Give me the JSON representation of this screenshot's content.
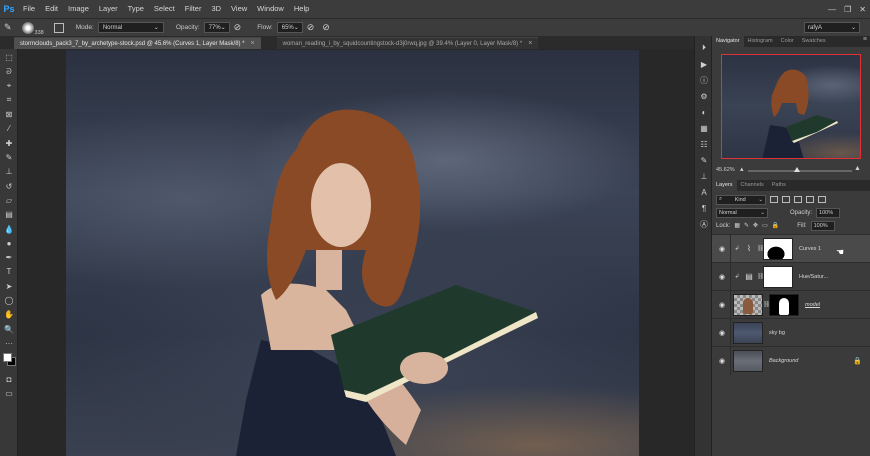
{
  "app": {
    "logo": "Ps"
  },
  "menu": [
    "File",
    "Edit",
    "Image",
    "Layer",
    "Type",
    "Select",
    "Filter",
    "3D",
    "View",
    "Window",
    "Help"
  ],
  "window_controls": {
    "minimize": "—",
    "restore": "❐",
    "close": "✕"
  },
  "options": {
    "brush_size": "338",
    "mode_label": "Mode:",
    "mode_value": "Normal",
    "opacity_label": "Opacity:",
    "opacity_value": "77%",
    "flow_label": "Flow:",
    "flow_value": "65%",
    "workspace": "rafyA"
  },
  "tabs": [
    {
      "label": "stormclouds_pack3_7_by_archetype-stock.psd @ 45.6% (Curves 1, Layer Mask/8) *",
      "close": "×"
    },
    {
      "label": "woman_reading_i_by_squidcountingstock-d3j0rwq.jpg @ 39.4% (Layer 0, Layer Mask/8) *",
      "close": "×"
    }
  ],
  "navigator": {
    "tabs": [
      "Navigator",
      "Histogram",
      "Color",
      "Swatches"
    ],
    "zoom": "45.62%",
    "panel_menu": "≡"
  },
  "layers_panel": {
    "tabs": [
      "Layers",
      "Channels",
      "Paths"
    ],
    "kind_label": "Kind",
    "blend_mode": "Normal",
    "opacity_label": "Opacity:",
    "opacity_value": "100%",
    "lock_label": "Lock:",
    "fill_label": "Fill:",
    "fill_value": "100%",
    "layers": [
      {
        "name": "Curves 1",
        "selected": true
      },
      {
        "name": "Hue/Satur..."
      },
      {
        "name": "model"
      },
      {
        "name": "sky bg"
      },
      {
        "name": "Background"
      }
    ]
  },
  "colors": {
    "foreground": "#ffffff",
    "background": "#000000",
    "accent": "#31a8ff",
    "navigator_frame": "#e0303a"
  }
}
